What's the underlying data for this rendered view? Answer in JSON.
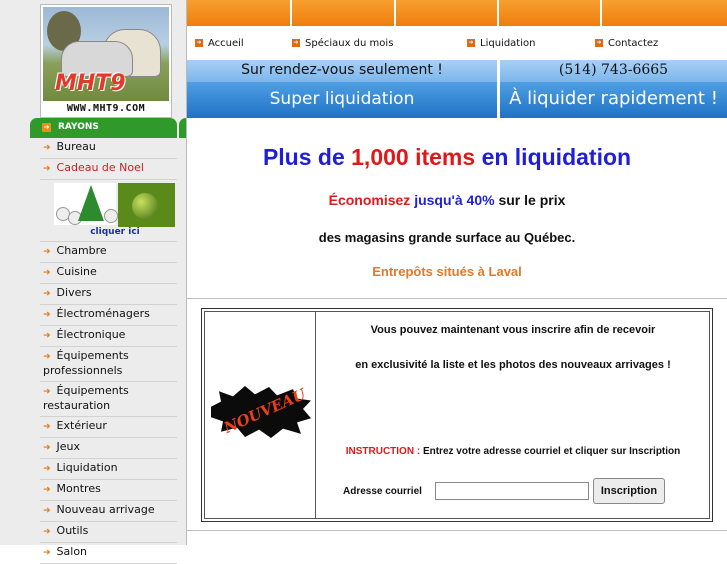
{
  "logo": {
    "brand": "MHT9",
    "url_text": "WWW.MHT9.COM"
  },
  "sidebar": {
    "header": "RAYONS",
    "categories_top": [
      {
        "label": "Bureau",
        "highlight": false
      },
      {
        "label": "Cadeau de Noel",
        "highlight": true
      }
    ],
    "noel_promo": {
      "link_text": "cliquer ici"
    },
    "categories": [
      "Chambre",
      "Cuisine",
      "Divers",
      "Électroménagers",
      "Électronique",
      "Équipements professionnels",
      "Équipements restauration",
      "Extérieur",
      "Jeux",
      "Liquidation",
      "Montres",
      "Nouveau arrivage",
      "Outils",
      "Salon"
    ]
  },
  "nav": {
    "items": [
      "Accueil",
      "Spéciaux du mois",
      "Liquidation",
      "Contactez"
    ]
  },
  "banner": {
    "appointment": "Sur rendez-vous seulement !",
    "phone": "(514) 743-6665",
    "left_slogan": "Super liquidation",
    "right_slogan": "À liquider rapidement !"
  },
  "main": {
    "headline_a": "Plus de",
    "headline_b": "1,000 items",
    "headline_c": "en liquidation",
    "savings_a": "Économisez",
    "savings_b": "jusqu'à 40%",
    "savings_c": "sur le prix",
    "line3": "des magasins grande surface au Québec.",
    "line4": "Entrepôts situés à Laval"
  },
  "signup": {
    "badge": "NOUVEAU",
    "text1": "Vous pouvez maintenant vous inscrire afin de recevoir",
    "text2": "en exclusivité la liste et les photos des nouveaux arrivages !",
    "instruction_label": "INSTRUCTION :",
    "instruction_text": "Entrez votre adresse courriel et cliquer sur Inscription",
    "email_label": "Adresse courriel",
    "email_value": "",
    "submit": "Inscription"
  },
  "colors": {
    "orange": "#ee7d0d",
    "green": "#2f9a2a",
    "blue": "#1f72c6",
    "red": "#e01818",
    "headline_blue": "#1f1fd8"
  }
}
